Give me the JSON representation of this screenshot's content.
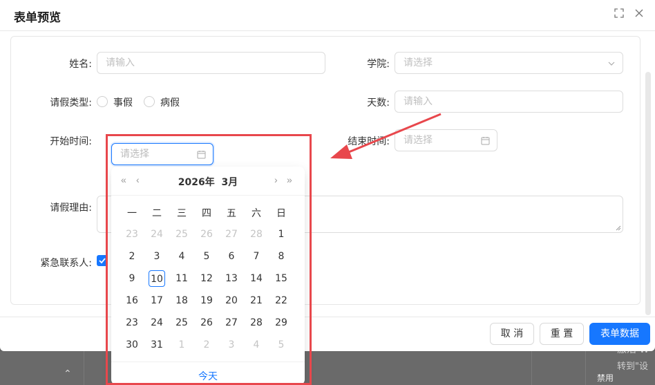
{
  "modal": {
    "title": "表单预览",
    "fields": {
      "name": {
        "label": "姓名:",
        "placeholder": "请输入"
      },
      "college": {
        "label": "学院:",
        "placeholder": "请选择"
      },
      "leave_type": {
        "label": "请假类型:",
        "options": [
          "事假",
          "病假"
        ]
      },
      "days": {
        "label": "天数:",
        "placeholder": "请输入"
      },
      "start_time": {
        "label": "开始时间:",
        "placeholder": "请选择"
      },
      "end_time": {
        "label": "结束时间:",
        "placeholder": "请选择"
      },
      "reason": {
        "label": "请假理由:"
      },
      "emergency_contact": {
        "label": "紧急联系人:"
      }
    },
    "footer": {
      "cancel": "取 消",
      "reset": "重 置",
      "submit": "表单数据"
    }
  },
  "datepicker": {
    "year": "2026年",
    "month": "3月",
    "weekdays": [
      "一",
      "二",
      "三",
      "四",
      "五",
      "六",
      "日"
    ],
    "weeks": [
      [
        "23",
        "24",
        "25",
        "26",
        "27",
        "28",
        "1"
      ],
      [
        "2",
        "3",
        "4",
        "5",
        "6",
        "7",
        "8"
      ],
      [
        "9",
        "10",
        "11",
        "12",
        "13",
        "14",
        "15"
      ],
      [
        "16",
        "17",
        "18",
        "19",
        "20",
        "21",
        "22"
      ],
      [
        "23",
        "24",
        "25",
        "26",
        "27",
        "28",
        "29"
      ],
      [
        "30",
        "31",
        "1",
        "2",
        "3",
        "4",
        "5"
      ]
    ],
    "selected_day": "10",
    "today_label": "今天"
  },
  "background": {
    "watermark_line1": "激活 W",
    "watermark_line2": "转到\"设",
    "status_text": "禁用"
  },
  "colors": {
    "primary": "#1677ff",
    "annotation": "#e8474c"
  },
  "icons": [
    "expand-icon",
    "close-icon",
    "chevron-down-icon",
    "calendar-icon",
    "double-left-icon",
    "left-icon",
    "right-icon",
    "double-right-icon",
    "check-icon"
  ]
}
